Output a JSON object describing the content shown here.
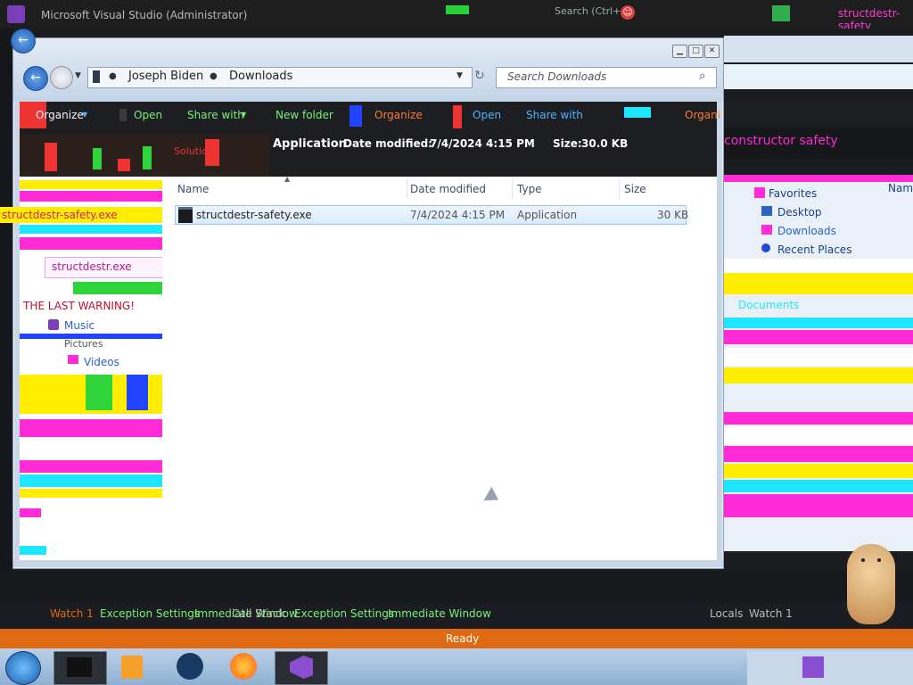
{
  "vs": {
    "title": "Microsoft Visual Studio (Administrator)",
    "search": "Search (Ctrl+Q)"
  },
  "explorer": {
    "breadcrumb": [
      "Joseph Biden",
      "Downloads"
    ],
    "search_placeholder": "Search Downloads",
    "toolbar": {
      "organize": "Organize",
      "open": "Open",
      "share_with": "Share with",
      "new_folder": "New folder"
    },
    "details": {
      "type": "Application",
      "date_label": "Date modified:",
      "date_value": "7/4/2024 4:15 PM",
      "size_label": "Size:",
      "size_value": "30.0 KB"
    },
    "columns": [
      "Name",
      "Date modified",
      "Type",
      "Size"
    ],
    "rows": [
      {
        "name": "structdestr-safety.exe",
        "date": "7/4/2024 4:15 PM",
        "type": "Application",
        "size": "30 KB"
      }
    ],
    "nav_glitch": {
      "file": "structdestr-safety.exe",
      "tab": "structdestr.exe",
      "warning": "THE LAST WARNING!",
      "music": "Music",
      "pictures": "Pictures",
      "videos": "Videos"
    }
  },
  "right_pane": {
    "favorites": "Favorites",
    "desktop": "Desktop",
    "downloads": "Downloads",
    "recent": "Recent Places",
    "documents": "Documents",
    "name_col": "Name"
  },
  "bottom": {
    "output_tabs": [
      "Watch 1",
      "Exception Settings",
      "Immediate Window",
      "Call Stack",
      "Exception Settings",
      "Immediate Window",
      "Locals",
      "Watch 1"
    ],
    "status": "Ready"
  },
  "taskbar": {
    "apps": [
      "start-orb",
      "terminal",
      "media-player",
      "steam",
      "firefox",
      "visual-studio"
    ]
  },
  "colors": {
    "status_orange": "#e06a12",
    "toolbar_green": "#7af07a",
    "glitch_magenta": "#ff2bd6",
    "glitch_yellow": "#ffee00",
    "glitch_cyan": "#1ee6ff"
  }
}
